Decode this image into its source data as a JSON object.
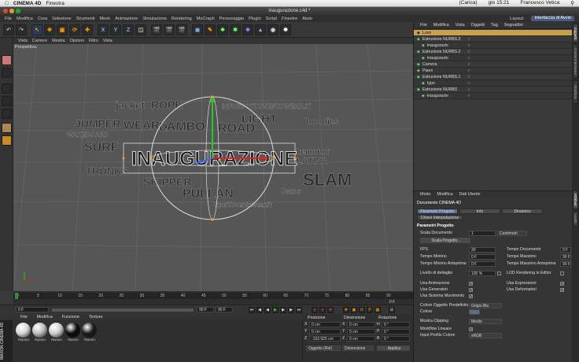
{
  "mac": {
    "apple": "",
    "app": "CINEMA 4D",
    "menu": "Finestra",
    "battery": "(Carica)",
    "clock": "gio 15:21",
    "user": "Francesco Vetica"
  },
  "window": {
    "title": "inaugurazione.c4d *"
  },
  "menubar": {
    "items": [
      "File",
      "Modifica",
      "Crea",
      "Selezione",
      "Strumenti",
      "Mesh",
      "Animazione",
      "Simulazione",
      "Rendering",
      "MoCraph",
      "Personaggio",
      "Plugin",
      "Script",
      "Finestre",
      "Aiuto"
    ],
    "layout_label": "Layout:",
    "layout_value": "Interfaccia di Avvio"
  },
  "toolbar": {
    "x": "X",
    "y": "Y",
    "z": "Z"
  },
  "viewport": {
    "menu": [
      "Vista",
      "Camere",
      "Mostra",
      "Opzioni",
      "Filtro",
      "Vista"
    ],
    "label": "Prospettiva",
    "words": [
      "jacket",
      "ROPE",
      "INFOSPOTTOVENTOWEAR.IT",
      "JUMPER",
      "WEARS",
      "LAMBO",
      "ROAD",
      "LIGHT",
      "hoodies",
      "INAUGURAZIONE",
      "SURF",
      "WAKEBOARD",
      "PULLAN",
      "SKIPPER",
      "SLAM",
      "LATINA",
      "kemonor",
      "TRUNKS",
      "Jeans",
      "SpotToventowear.it"
    ]
  },
  "timeline": {
    "ticks": [
      "0",
      "5",
      "10",
      "15",
      "20",
      "25",
      "30",
      "35",
      "40",
      "45",
      "50",
      "55",
      "60",
      "65",
      "70",
      "75",
      "80",
      "85",
      "90"
    ],
    "end": "0 F"
  },
  "transport": {
    "start": "0 F",
    "end_a": "90 F",
    "end_b": "90 F"
  },
  "materials": {
    "menu": [
      "File",
      "Modifica",
      "Funzione",
      "Texture"
    ],
    "items": [
      {
        "label": "Nuovo",
        "color": "#d8d8d8"
      },
      {
        "label": "Nuovo",
        "color": "#bdbdbd"
      },
      {
        "label": "Nuovo",
        "color": "#cfcfcf"
      },
      {
        "label": "Nuovo",
        "color": "#0a0a0a"
      },
      {
        "label": "Nuovo",
        "color": "#1a1a1a"
      }
    ],
    "brand": "MAXON CINEMA 4D"
  },
  "coords": {
    "headers": [
      "Posizione",
      "Dimensione",
      "Rotazione"
    ],
    "rows": [
      {
        "axis": "X",
        "pos": "0 cm",
        "dim": "0 cm",
        "rot_axis": "H",
        "rot": "0 °"
      },
      {
        "axis": "Y",
        "pos": "0 cm",
        "dim": "0 cm",
        "rot_axis": "P",
        "rot": "0 °"
      },
      {
        "axis": "Z",
        "pos": "-102.925 cm",
        "dim": "0 cm",
        "rot_axis": "B",
        "rot": "0 °"
      }
    ],
    "mode": "Oggetto (Rel)",
    "dim_mode": "Dimensione",
    "apply": "Applica"
  },
  "objects": {
    "menu": [
      "File",
      "Modifica",
      "Vista",
      "Oggetti",
      "Tag",
      "Segnalibri"
    ],
    "rows": [
      {
        "name": "Luce",
        "indent": 0,
        "selected": true
      },
      {
        "name": "Estrusione NURBS.3",
        "indent": 0
      },
      {
        "name": "inaugurazio",
        "indent": 1
      },
      {
        "name": "Estrusione NURBS.2",
        "indent": 0
      },
      {
        "name": "inaugurazio",
        "indent": 1
      },
      {
        "name": "Camera",
        "indent": 0
      },
      {
        "name": "Piano",
        "indent": 0
      },
      {
        "name": "Estrusione NURBS.1",
        "indent": 0
      },
      {
        "name": "typo",
        "indent": 1
      },
      {
        "name": "Estrusione NURBS",
        "indent": 0
      },
      {
        "name": "inaugurazio",
        "indent": 1
      }
    ]
  },
  "attributes": {
    "menu": [
      "Modo",
      "Modifica",
      "Dati Utente"
    ],
    "doc": "Documento CINEMA 4D",
    "tabs": [
      "Parametri Progetto",
      "Info",
      "Dinamics"
    ],
    "tab2": "Chiavi Interpolazione",
    "section": "Parametri Progetto",
    "scala_lbl": "Scala Documento",
    "scala_val": "1",
    "scala_unit": "Centimetri",
    "scala_btn": "Scala Progetto...",
    "fps_lbl": "FPS",
    "fps_val": "30",
    "tdoc_lbl": "Tempo Documento",
    "tdoc_val": "0 F",
    "tmin_lbl": "Tempo Minimo",
    "tmin_val": "0 F",
    "tmax_lbl": "Tempo Massimo",
    "tmax_val": "90 F",
    "tminp_lbl": "Tempo Minimo Anteprima",
    "tminp_val": "0 F",
    "tmaxp_lbl": "Tempo Massimo Anteprima",
    "tmaxp_val": "90 F",
    "lod_lbl": "Livello di dettaglio",
    "lod_val": "100 %",
    "lodr_lbl": "LOD Rendering in Editor",
    "checks": [
      "Usa Animazione",
      "Usa Generatori",
      "Usa Sistema Movimento",
      "Usa Espressioni",
      "Usa Deformatori"
    ],
    "col_lbl": "Colore Oggetto Predefinito",
    "col_val": "Grigio-Blu",
    "colore_lbl": "Colore",
    "clip_lbl": "Mostra Clipping",
    "clip_val": "Medio",
    "wf_lbl": "Workflow Lineare",
    "prof_lbl": "Input Profilo Colore",
    "prof_val": "sRGB"
  },
  "sidetabs": [
    "Oggetti",
    "Content Browser",
    "Struttura",
    "Attributi",
    "Livelli"
  ]
}
